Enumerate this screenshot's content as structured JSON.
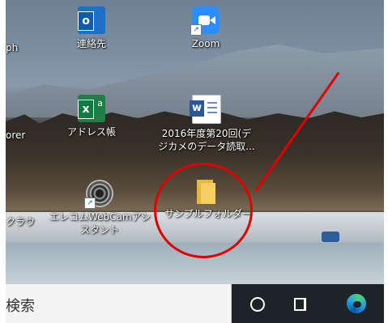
{
  "desktop": {
    "icons": [
      {
        "id": "outlook-contacts",
        "label": "連絡先",
        "icon": "outlook-icon"
      },
      {
        "id": "zoom",
        "label": "Zoom",
        "icon": "zoom-icon"
      },
      {
        "id": "excel-address",
        "label": "アドレス帳",
        "icon": "excel-icon"
      },
      {
        "id": "word-doc",
        "label_line1": "2016年度第20回(デ",
        "label_line2": "ジカメのデータ読取...",
        "icon": "word-icon"
      },
      {
        "id": "webcam",
        "label_line1": "エレコムWebCamアシ",
        "label_line2": "スタント",
        "icon": "webcam-icon"
      },
      {
        "id": "sample-folder",
        "label": "サンプルフォルダー",
        "icon": "folder-icon"
      }
    ],
    "partial_labels": {
      "ph": "ph",
      "orer": "orer",
      "kura": "クラウ"
    }
  },
  "annotation": {
    "color": "#e00000"
  },
  "taskbar": {
    "search_text": "検索",
    "icons": [
      "cortana-icon",
      "task-view-icon",
      "edge-icon"
    ]
  }
}
